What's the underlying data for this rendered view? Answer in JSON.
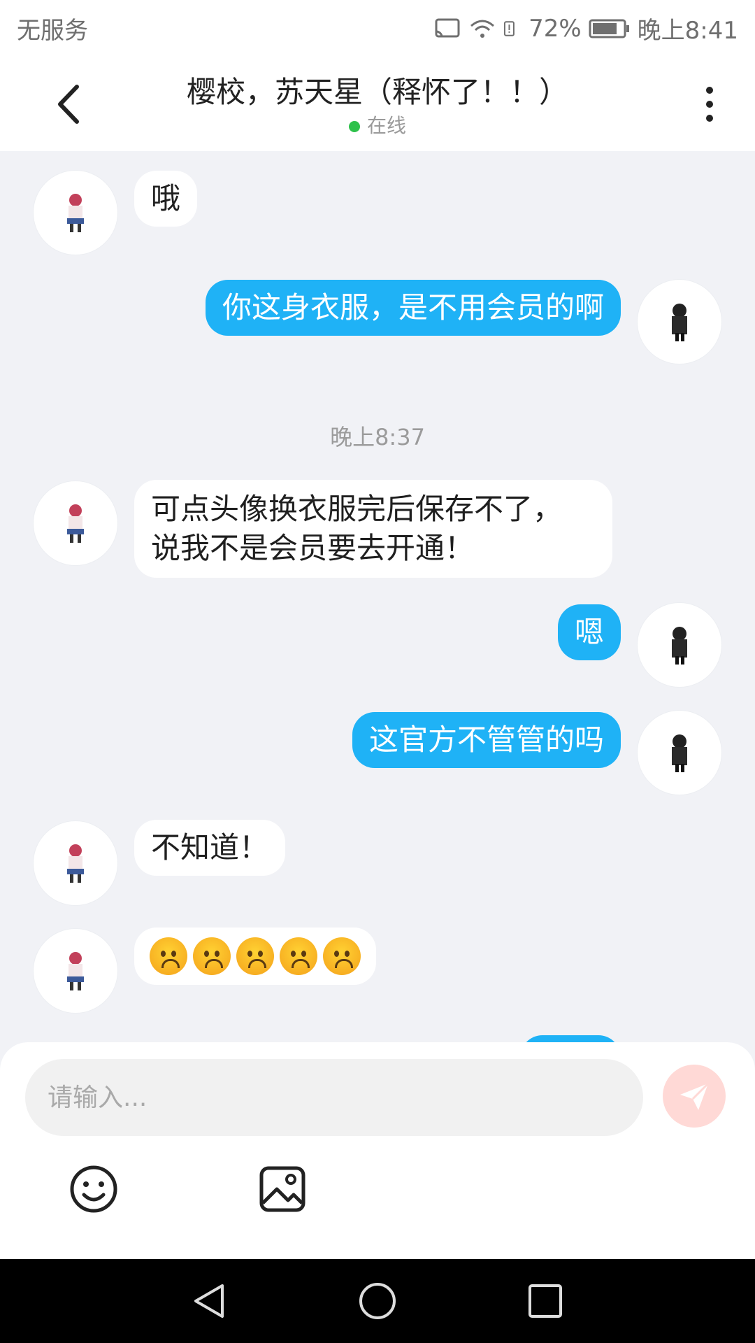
{
  "status_bar": {
    "carrier": "无服务",
    "battery": "72%",
    "time": "晚上8:41"
  },
  "header": {
    "title": "樱校，苏天星（释怀了！！）",
    "presence": "在线"
  },
  "messages": [
    {
      "side": "in",
      "text": "哦"
    },
    {
      "side": "out",
      "text": "你这身衣服，是不用会员的啊"
    },
    {
      "type": "timestamp",
      "text": "晚上8:37"
    },
    {
      "side": "in",
      "text_line1": "可点头像换衣服完后保存不了，",
      "text_line2": "说我不是会员要去开通！"
    },
    {
      "side": "out",
      "text": "嗯"
    },
    {
      "side": "out",
      "text": "这官方不管管的吗"
    },
    {
      "side": "in",
      "text": "不知道！"
    },
    {
      "side": "in",
      "emoji": [
        "worried-face",
        "worried-face",
        "worried-face",
        "worried-face",
        "worried-face"
      ]
    }
  ],
  "composer": {
    "placeholder": "请输入...",
    "send_icon": "send-icon",
    "emoji_icon": "smiley-icon",
    "image_icon": "image-icon"
  },
  "colors": {
    "outgoing_bubble": "#1fb2f6",
    "incoming_bubble": "#ffffff",
    "online_dot": "#2ec14b",
    "send_button": "#ffd9d6"
  }
}
